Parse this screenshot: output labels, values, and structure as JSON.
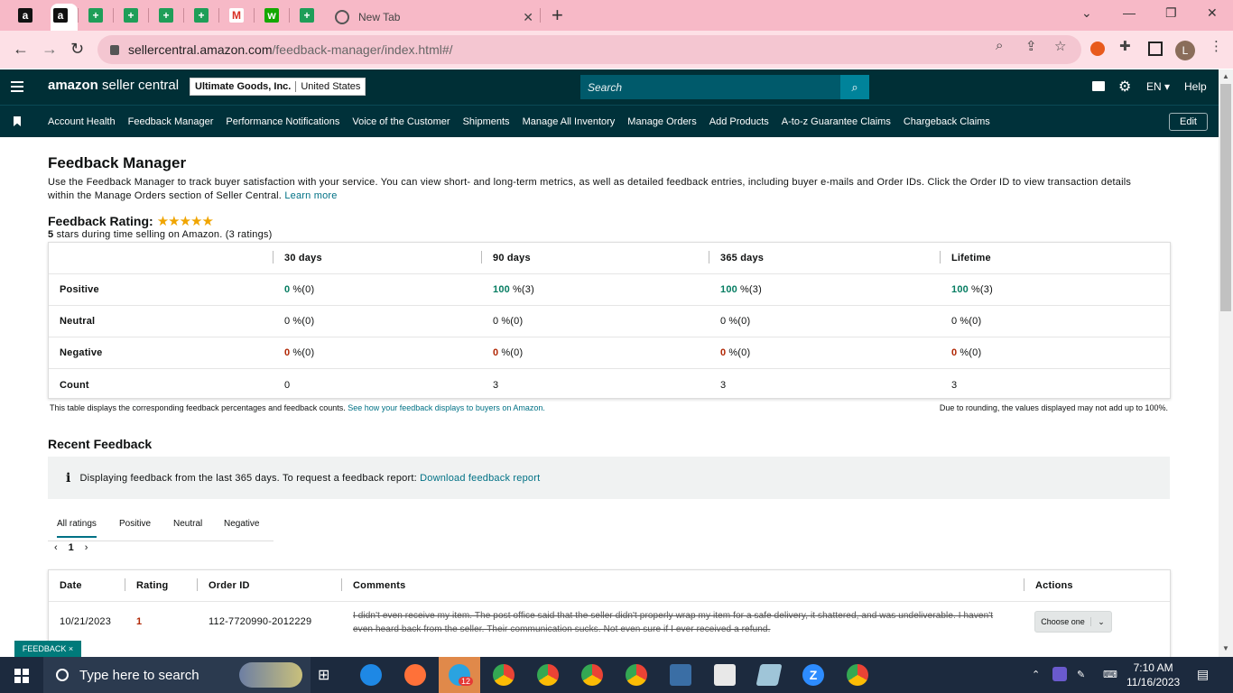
{
  "browser": {
    "tab_active_title": "New Tab",
    "url_host": "sellercentral.amazon.com",
    "url_path": "/feedback-manager/index.html#/",
    "profile_initial": "L",
    "colors": {
      "tabstrip": "#f7b9c7",
      "toolbar": "#fde0e6"
    }
  },
  "header": {
    "logo_brand": "amazon",
    "logo_product": " seller central",
    "account_name": "Ultimate Goods, Inc.",
    "marketplace": "United States",
    "search_placeholder": "Search",
    "language": "EN",
    "help": "Help",
    "colors": {
      "header_bg": "#002f36",
      "search_btn": "#00839a"
    }
  },
  "nav": {
    "items": [
      "Account Health",
      "Feedback Manager",
      "Performance Notifications",
      "Voice of the Customer",
      "Shipments",
      "Manage All Inventory",
      "Manage Orders",
      "Add Products",
      "A-to-z Guarantee Claims",
      "Chargeback Claims"
    ],
    "edit": "Edit"
  },
  "page": {
    "title": "Feedback Manager",
    "description": "Use the Feedback Manager to track buyer satisfaction with your service. You can view short- and long-term metrics, as well as detailed feedback entries, including buyer e-mails and Order IDs. Click the Order ID to view transaction details within the Manage Orders section of Seller Central.",
    "learn_more": "Learn more",
    "rating_label": "Feedback Rating:",
    "stars": "★★★★★",
    "rating_sub_bold": "5",
    "rating_sub_rest": " stars during time selling on Amazon. (3 ratings)"
  },
  "metrics_table": {
    "headers": [
      "30 days",
      "90 days",
      "365 days",
      "Lifetime"
    ],
    "rows": [
      {
        "label": "Positive",
        "cells": [
          [
            "0",
            " %(0)"
          ],
          [
            "100",
            " %(3)"
          ],
          [
            "100",
            " %(3)"
          ],
          [
            "100",
            " %(3)"
          ]
        ]
      },
      {
        "label": "Neutral",
        "cells": [
          [
            "0",
            " %(0)"
          ],
          [
            "0",
            " %(0)"
          ],
          [
            "0",
            " %(0)"
          ],
          [
            "0",
            " %(0)"
          ]
        ]
      },
      {
        "label": "Negative",
        "cells": [
          [
            "0",
            " %(0)"
          ],
          [
            "0",
            " %(0)"
          ],
          [
            "0",
            " %(0)"
          ],
          [
            "0",
            " %(0)"
          ]
        ]
      },
      {
        "label": "Count",
        "cells": [
          [
            "0",
            ""
          ],
          [
            "3",
            ""
          ],
          [
            "3",
            ""
          ],
          [
            "3",
            ""
          ]
        ]
      }
    ],
    "note_left": "This table displays the corresponding feedback percentages and feedback counts.",
    "note_link": "See how your feedback displays to buyers on Amazon.",
    "note_right": "Due to rounding, the values displayed may not add up to 100%."
  },
  "recent": {
    "title": "Recent Feedback",
    "info_text": "Displaying feedback from the last 365 days. To request a feedback report:",
    "info_link": "Download feedback report",
    "tabs": [
      "All ratings",
      "Positive",
      "Neutral",
      "Negative"
    ],
    "page": "1",
    "columns": [
      "Date",
      "Rating",
      "Order ID",
      "Comments",
      "Actions"
    ],
    "rows": [
      {
        "date": "10/21/2023",
        "rating": "1",
        "order_id": "112-7720990-2012229",
        "comment": "I didn't even receive my item. The post office said that the seller didn't properly wrap my item for a safe delivery, it shattered, and was undeliverable. I haven't even heard back from the seller. Their communication sucks. Not even sure if I ever received a refund.",
        "action": "Choose one"
      }
    ],
    "feedback_badge": "FEEDBACK ×"
  },
  "taskbar": {
    "search_placeholder": "Type here to search",
    "badge": "12",
    "time": "7:10 AM",
    "date": "11/16/2023"
  }
}
